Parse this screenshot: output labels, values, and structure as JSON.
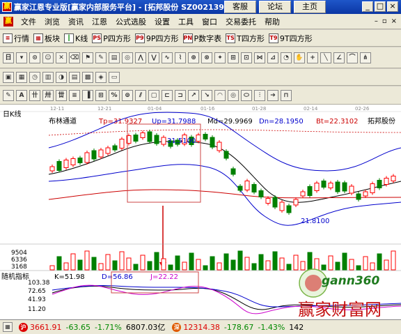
{
  "window": {
    "title": "赢家江恩专业版[赢家内部服务平台] - [拓邦股份  SZ002139]",
    "buttons": [
      "客服",
      "论坛",
      "主页"
    ]
  },
  "menu": [
    "文件",
    "浏览",
    "资讯",
    "江恩",
    "公式选股",
    "设置",
    "工具",
    "窗口",
    "交易委托",
    "帮助"
  ],
  "toolbar1": [
    {
      "icon": "list-icon",
      "label": "行情"
    },
    {
      "icon": "grid-icon",
      "label": "板块"
    },
    {
      "icon": "kline-icon",
      "label": "K线"
    },
    {
      "icon": "p-square-icon",
      "label": "P四方形"
    },
    {
      "icon": "9p-square-icon",
      "label": "9P四方形"
    },
    {
      "icon": "pn-icon",
      "label": "P数字表"
    },
    {
      "icon": "t-square-icon",
      "label": "T四方形"
    },
    {
      "icon": "9t-square-icon",
      "label": "9T四方形"
    }
  ],
  "chart_panel": {
    "period_label": "日K线",
    "indicator": "布林通道",
    "tp": "Tp=31.9327",
    "up": "Up=31.7988",
    "md": "Md=29.9969",
    "dn": "Dn=28.1950",
    "bt": "Bt=22.3102",
    "stock_name": "拓邦股份",
    "date_ticks": [
      "12-11",
      "12-21",
      "01-04",
      "01-16",
      "01-28",
      "02-14",
      "02-26"
    ],
    "price_high_label": "31.5100",
    "price_low_label": "21.8100",
    "volume_ticks": [
      "9504",
      "6336",
      "3168"
    ],
    "kdj_title": "随机指标",
    "k": "K=51.98",
    "d": "D=56.86",
    "j": "J=22.22",
    "kdj_ticks": [
      "103.38",
      "72.65",
      "41.93",
      "11.20"
    ]
  },
  "status": {
    "sh_badge": "沪",
    "sh_index": "3661.91",
    "sh_change": "-63.65",
    "sh_pct": "-1.71%",
    "sh_amount": "6807.03亿",
    "sz_badge": "深",
    "sz_index": "12314.38",
    "sz_change": "-178.67",
    "sz_pct": "-1.43%",
    "sz_amount": "142"
  },
  "watermark": {
    "brand": "gann360",
    "cn_text": "赢家财富网"
  },
  "colors": {
    "up": "#ff0000",
    "down": "#008000",
    "boll": "#0000cc",
    "md": "#000000",
    "tp": "#cc0000"
  }
}
